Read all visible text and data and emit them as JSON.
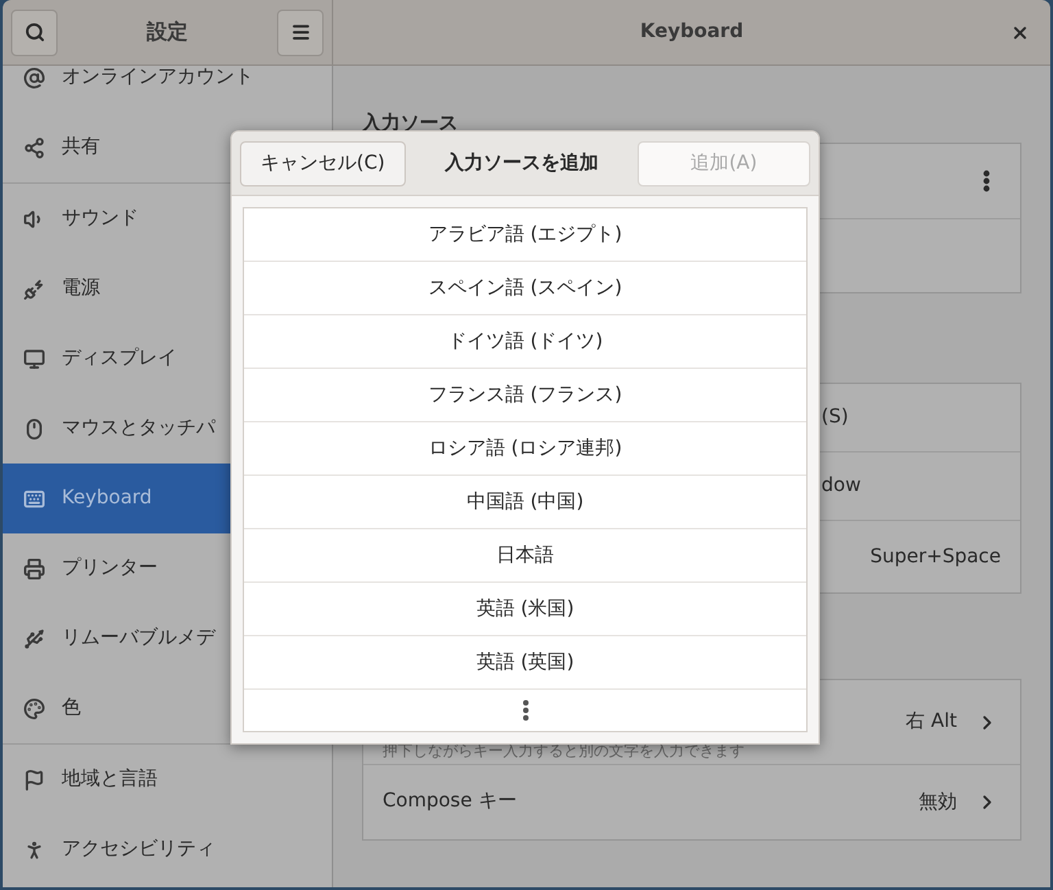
{
  "header": {
    "sidebar_title": "設定",
    "title": "Keyboard"
  },
  "sidebar": {
    "groups": [
      [
        {
          "label": "オンラインアカウント",
          "selected": false
        },
        {
          "label": "共有",
          "selected": false
        }
      ],
      [
        {
          "label": "サウンド",
          "selected": false
        },
        {
          "label": "電源",
          "selected": false
        },
        {
          "label": "ディスプレイ",
          "selected": false
        },
        {
          "label": "マウスとタッチパ",
          "selected": false
        },
        {
          "label": "Keyboard",
          "selected": true
        },
        {
          "label": "プリンター",
          "selected": false
        },
        {
          "label": "リムーバブルメデ",
          "selected": false
        },
        {
          "label": "色",
          "selected": false
        }
      ],
      [
        {
          "label": "地域と言語",
          "selected": false
        },
        {
          "label": "アクセシビリティ",
          "selected": false
        }
      ]
    ]
  },
  "content": {
    "heading": "入力ソース",
    "shortcuts": [
      {
        "value": "(S)"
      },
      {
        "value": "dow"
      },
      {
        "value": "Super+Space"
      }
    ],
    "special_keys": [
      {
        "description": "押下しながらキー入力すると別の文字を入力できます",
        "value": "右 Alt"
      },
      {
        "label": "Compose キー",
        "value": "無効"
      }
    ]
  },
  "dialog": {
    "cancel": "キャンセル(C)",
    "title": "入力ソースを追加",
    "add": {
      "label": "追加(A)",
      "disabled": true
    },
    "items": [
      "アラビア語 (エジプト)",
      "スペイン語 (スペイン)",
      "ドイツ語 (ドイツ)",
      "フランス語 (フランス)",
      "ロシア語 (ロシア連邦)",
      "中国語 (中国)",
      "日本語",
      "英語 (米国)",
      "英語 (英国)"
    ]
  }
}
